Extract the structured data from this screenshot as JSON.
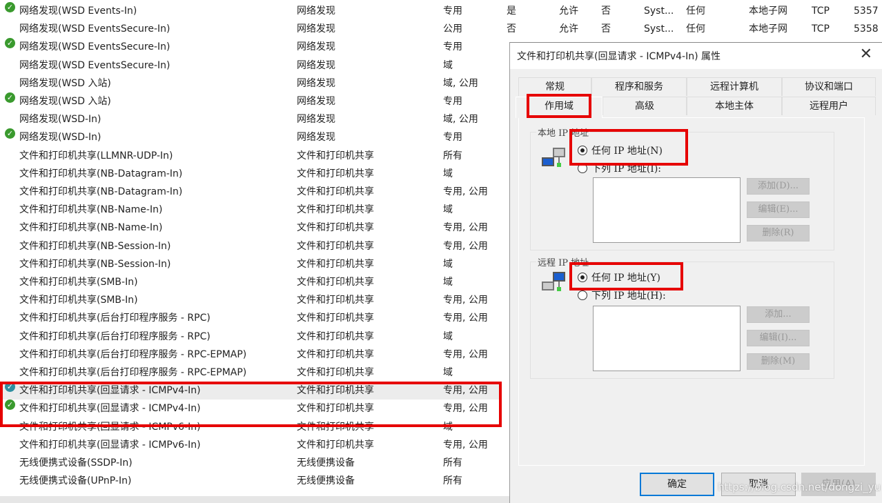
{
  "rules": [
    {
      "icon": "check",
      "name": "网络发现(WSD Events-In)",
      "group": "网络发现",
      "profile": "专用",
      "extra": [
        "是",
        "允许",
        "否",
        "Syst...",
        "任何",
        "本地子网",
        "TCP",
        "5357"
      ]
    },
    {
      "icon": "",
      "name": "网络发现(WSD EventsSecure-In)",
      "group": "网络发现",
      "profile": "公用",
      "extra": [
        "否",
        "允许",
        "否",
        "Syst...",
        "任何",
        "本地子网",
        "TCP",
        "5358"
      ]
    },
    {
      "icon": "check",
      "name": "网络发现(WSD EventsSecure-In)",
      "group": "网络发现",
      "profile": "专用"
    },
    {
      "icon": "",
      "name": "网络发现(WSD EventsSecure-In)",
      "group": "网络发现",
      "profile": "域"
    },
    {
      "icon": "",
      "name": "网络发现(WSD 入站)",
      "group": "网络发现",
      "profile": "域, 公用"
    },
    {
      "icon": "check",
      "name": "网络发现(WSD 入站)",
      "group": "网络发现",
      "profile": "专用"
    },
    {
      "icon": "",
      "name": "网络发现(WSD-In)",
      "group": "网络发现",
      "profile": "域, 公用"
    },
    {
      "icon": "check",
      "name": "网络发现(WSD-In)",
      "group": "网络发现",
      "profile": "专用"
    },
    {
      "icon": "",
      "name": "文件和打印机共享(LLMNR-UDP-In)",
      "group": "文件和打印机共享",
      "profile": "所有"
    },
    {
      "icon": "",
      "name": "文件和打印机共享(NB-Datagram-In)",
      "group": "文件和打印机共享",
      "profile": "域"
    },
    {
      "icon": "",
      "name": "文件和打印机共享(NB-Datagram-In)",
      "group": "文件和打印机共享",
      "profile": "专用, 公用"
    },
    {
      "icon": "",
      "name": "文件和打印机共享(NB-Name-In)",
      "group": "文件和打印机共享",
      "profile": "域"
    },
    {
      "icon": "",
      "name": "文件和打印机共享(NB-Name-In)",
      "group": "文件和打印机共享",
      "profile": "专用, 公用"
    },
    {
      "icon": "",
      "name": "文件和打印机共享(NB-Session-In)",
      "group": "文件和打印机共享",
      "profile": "专用, 公用"
    },
    {
      "icon": "",
      "name": "文件和打印机共享(NB-Session-In)",
      "group": "文件和打印机共享",
      "profile": "域"
    },
    {
      "icon": "",
      "name": "文件和打印机共享(SMB-In)",
      "group": "文件和打印机共享",
      "profile": "域"
    },
    {
      "icon": "",
      "name": "文件和打印机共享(SMB-In)",
      "group": "文件和打印机共享",
      "profile": "专用, 公用"
    },
    {
      "icon": "",
      "name": "文件和打印机共享(后台打印程序服务 - RPC)",
      "group": "文件和打印机共享",
      "profile": "专用, 公用"
    },
    {
      "icon": "",
      "name": "文件和打印机共享(后台打印程序服务 - RPC)",
      "group": "文件和打印机共享",
      "profile": "域"
    },
    {
      "icon": "",
      "name": "文件和打印机共享(后台打印程序服务 - RPC-EPMAP)",
      "group": "文件和打印机共享",
      "profile": "专用, 公用"
    },
    {
      "icon": "",
      "name": "文件和打印机共享(后台打印程序服务 - RPC-EPMAP)",
      "group": "文件和打印机共享",
      "profile": "域"
    },
    {
      "icon": "check-teal",
      "selected": true,
      "name": "文件和打印机共享(回显请求 - ICMPv4-In)",
      "group": "文件和打印机共享",
      "profile": "专用, 公用"
    },
    {
      "icon": "check",
      "name": "文件和打印机共享(回显请求 - ICMPv4-In)",
      "group": "文件和打印机共享",
      "profile": "专用, 公用"
    },
    {
      "icon": "",
      "name": "文件和打印机共享(回显请求 - ICMPv6-In)",
      "group": "文件和打印机共享",
      "profile": "域"
    },
    {
      "icon": "",
      "name": "文件和打印机共享(回显请求 - ICMPv6-In)",
      "group": "文件和打印机共享",
      "profile": "专用, 公用"
    },
    {
      "icon": "",
      "name": "无线便携式设备(SSDP-In)",
      "group": "无线便携设备",
      "profile": "所有"
    },
    {
      "icon": "",
      "name": "无线便携式设备(UPnP-In)",
      "group": "无线便携设备",
      "profile": "所有"
    }
  ],
  "dialog": {
    "title": "文件和打印机共享(回显请求 - ICMPv4-In) 属性",
    "close_icon": "close-icon",
    "tabs_row1": [
      "常规",
      "程序和服务",
      "远程计算机",
      "协议和端口"
    ],
    "tabs_row2": [
      "作用域",
      "高级",
      "本地主体",
      "远程用户"
    ],
    "active_tab": "作用域",
    "local": {
      "label": "本地 IP 地址",
      "any": "任何 IP 地址(N)",
      "list": "下列 IP 地址(I):",
      "selected": "any",
      "add": "添加(D)...",
      "edit": "编辑(E)...",
      "remove": "删除(R)"
    },
    "remote": {
      "label": "远程 IP 地址",
      "any": "任何 IP 地址(Y)",
      "list": "下列 IP 地址(H):",
      "selected": "any",
      "add": "添加...",
      "edit": "编辑(I)...",
      "remove": "删除(M)"
    },
    "ok": "确定",
    "cancel": "取消",
    "apply": "应用(A)"
  },
  "watermark": "https://blog.csdn.net/dongzi_yu",
  "colors": {
    "highlight": "#e60000",
    "check": "#3a9a2e",
    "accent": "#0078d7"
  }
}
